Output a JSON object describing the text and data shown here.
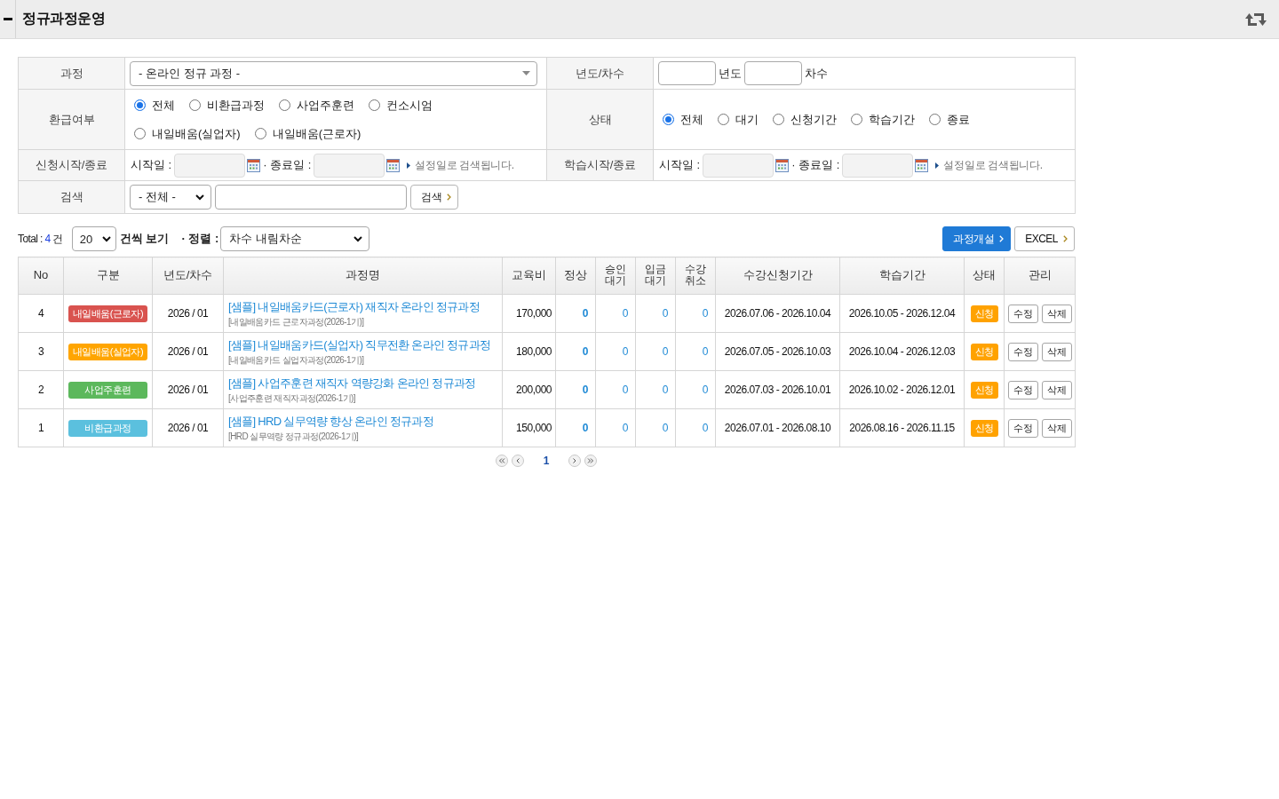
{
  "header": {
    "title": "정규과정운영"
  },
  "filters": {
    "course": {
      "label": "과정",
      "value": "- 온라인 정규 과정 -"
    },
    "year_round": {
      "label": "년도/차수",
      "year_suffix": "년도",
      "round_suffix": "차수"
    },
    "refund": {
      "label": "환급여부",
      "options": [
        {
          "label": "전체",
          "selected": true
        },
        {
          "label": "비환급과정",
          "selected": false
        },
        {
          "label": "사업주훈련",
          "selected": false
        },
        {
          "label": "컨소시엄",
          "selected": false
        },
        {
          "label": "내일배움(실업자)",
          "selected": false
        },
        {
          "label": "내일배움(근로자)",
          "selected": false
        }
      ]
    },
    "status": {
      "label": "상태",
      "options": [
        {
          "label": "전체",
          "selected": true
        },
        {
          "label": "대기",
          "selected": false
        },
        {
          "label": "신청기간",
          "selected": false
        },
        {
          "label": "학습기간",
          "selected": false
        },
        {
          "label": "종료",
          "selected": false
        }
      ]
    },
    "apply_period": {
      "label": "신청시작/종료",
      "start_label": "시작일 :",
      "end_label": "· 종료일 :",
      "note": "설정일로 검색됩니다."
    },
    "study_period": {
      "label": "학습시작/종료",
      "start_label": "시작일 :",
      "end_label": "· 종료일 :",
      "note": "설정일로 검색됩니다."
    },
    "search": {
      "label": "검색",
      "scope": "- 전체 -",
      "button": "검색"
    }
  },
  "toolbar": {
    "total_label": "Total :",
    "total": "4",
    "total_unit": "건",
    "page_size": "20",
    "page_size_suffix": "건씩 보기",
    "sort_label": "· 정렬 :",
    "sort": "차수 내림차순",
    "buttons": [
      {
        "label": "과정개설",
        "kind": "primary"
      },
      {
        "label": "EXCEL",
        "kind": "plain"
      }
    ]
  },
  "table": {
    "columns": [
      "No",
      "구분",
      "년도/차수",
      "과정명",
      "교육비",
      "정상",
      "승인 대기",
      "입금 대기",
      "수강 취소",
      "수강신청기간",
      "학습기간",
      "상태",
      "관리"
    ],
    "rows": [
      {
        "no": "4",
        "category": {
          "label": "내일배움(근로자)",
          "color": "#d9534f"
        },
        "year_round": "2026 / 01",
        "title": "[샘플] 내일배움카드(근로자) 재직자 온라인 정규과정",
        "subtitle": "[내일배움카드 근로자과정(2026-1기)]",
        "fee": "170,000",
        "counts": [
          "0",
          "0",
          "0",
          "0"
        ],
        "apply_period": "2026.07.06 - 2026.10.04",
        "study_period": "2026.10.05 - 2026.12.04",
        "status": "신청",
        "actions": [
          "수정",
          "삭제"
        ]
      },
      {
        "no": "3",
        "category": {
          "label": "내일배움(실업자)",
          "color": "#ffa500"
        },
        "year_round": "2026 / 01",
        "title": "[샘플] 내일배움카드(실업자) 직무전환 온라인 정규과정",
        "subtitle": "[내일배움카드 실업자과정(2026-1기)]",
        "fee": "180,000",
        "counts": [
          "0",
          "0",
          "0",
          "0"
        ],
        "apply_period": "2026.07.05 - 2026.10.03",
        "study_period": "2026.10.04 - 2026.12.03",
        "status": "신청",
        "actions": [
          "수정",
          "삭제"
        ]
      },
      {
        "no": "2",
        "category": {
          "label": "사업주훈련",
          "color": "#5cb85c"
        },
        "year_round": "2026 / 01",
        "title": "[샘플] 사업주훈련 재직자 역량강화 온라인 정규과정",
        "subtitle": "[사업주훈련 재직자과정(2026-1기)]",
        "fee": "200,000",
        "counts": [
          "0",
          "0",
          "0",
          "0"
        ],
        "apply_period": "2026.07.03 - 2026.10.01",
        "study_period": "2026.10.02 - 2026.12.01",
        "status": "신청",
        "actions": [
          "수정",
          "삭제"
        ]
      },
      {
        "no": "1",
        "category": {
          "label": "비환급과정",
          "color": "#5bc0de"
        },
        "year_round": "2026 / 01",
        "title": "[샘플] HRD 실무역량 향상 온라인 정규과정",
        "subtitle": "[HRD 실무역량 정규과정(2026-1기)]",
        "fee": "150,000",
        "counts": [
          "0",
          "0",
          "0",
          "0"
        ],
        "apply_period": "2026.07.01 - 2026.08.10",
        "study_period": "2026.08.16 - 2026.11.15",
        "status": "신청",
        "actions": [
          "수정",
          "삭제"
        ]
      }
    ]
  },
  "pagination": {
    "pages": [
      {
        "label": "1",
        "selected": true
      }
    ]
  }
}
